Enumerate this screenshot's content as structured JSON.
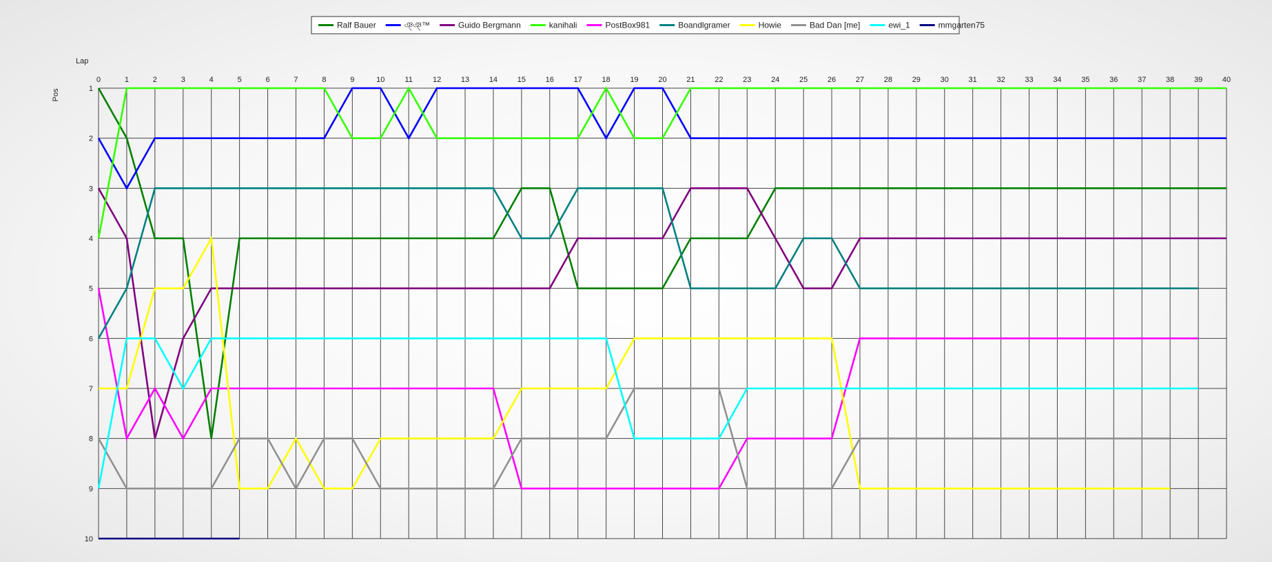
{
  "chart_data": {
    "type": "line",
    "xlabel": "Lap",
    "ylabel": "Pos",
    "xlim": [
      0,
      40
    ],
    "ylim": [
      1,
      10
    ],
    "y_inverted": true,
    "grid": true,
    "legend_position": "top-center",
    "x_ticks": [
      0,
      1,
      2,
      3,
      4,
      5,
      6,
      7,
      8,
      9,
      10,
      11,
      12,
      13,
      14,
      15,
      16,
      17,
      18,
      19,
      20,
      21,
      22,
      23,
      24,
      25,
      26,
      27,
      28,
      29,
      30,
      31,
      32,
      33,
      34,
      35,
      36,
      37,
      38,
      39,
      40
    ],
    "y_ticks": [
      1,
      2,
      3,
      4,
      5,
      6,
      7,
      8,
      9,
      10
    ],
    "series": [
      {
        "name": "Ralf Bauer",
        "color": "#008000",
        "values": [
          1,
          2,
          4,
          4,
          8,
          4,
          4,
          4,
          4,
          4,
          4,
          4,
          4,
          4,
          4,
          3,
          3,
          5,
          5,
          5,
          5,
          4,
          4,
          4,
          3,
          3,
          3,
          3,
          3,
          3,
          3,
          3,
          3,
          3,
          3,
          3,
          3,
          3,
          3,
          3,
          3
        ]
      },
      {
        "name": "ঞ্ঞ্™",
        "color": "#0000ff",
        "values": [
          2,
          3,
          2,
          2,
          2,
          2,
          2,
          2,
          2,
          1,
          1,
          2,
          1,
          1,
          1,
          1,
          1,
          1,
          2,
          1,
          1,
          2,
          2,
          2,
          2,
          2,
          2,
          2,
          2,
          2,
          2,
          2,
          2,
          2,
          2,
          2,
          2,
          2,
          2,
          2,
          2
        ]
      },
      {
        "name": "Guido Bergmann",
        "color": "#800080",
        "values": [
          3,
          4,
          8,
          6,
          5,
          5,
          5,
          5,
          5,
          5,
          5,
          5,
          5,
          5,
          5,
          5,
          5,
          4,
          4,
          4,
          4,
          3,
          3,
          3,
          4,
          5,
          5,
          4,
          4,
          4,
          4,
          4,
          4,
          4,
          4,
          4,
          4,
          4,
          4,
          4,
          4
        ]
      },
      {
        "name": "kanihali",
        "color": "#33ff00",
        "values": [
          4,
          1,
          1,
          1,
          1,
          1,
          1,
          1,
          1,
          2,
          2,
          1,
          2,
          2,
          2,
          2,
          2,
          2,
          1,
          2,
          2,
          1,
          1,
          1,
          1,
          1,
          1,
          1,
          1,
          1,
          1,
          1,
          1,
          1,
          1,
          1,
          1,
          1,
          1,
          1,
          1
        ]
      },
      {
        "name": "PostBox981",
        "color": "#ff00ff",
        "values": [
          5,
          8,
          7,
          8,
          7,
          7,
          7,
          7,
          7,
          7,
          7,
          7,
          7,
          7,
          7,
          9,
          9,
          9,
          9,
          9,
          9,
          9,
          9,
          8,
          8,
          8,
          8,
          6,
          6,
          6,
          6,
          6,
          6,
          6,
          6,
          6,
          6,
          6,
          6,
          6
        ]
      },
      {
        "name": "Boandlgramer",
        "color": "#008080",
        "values": [
          6,
          5,
          3,
          3,
          3,
          3,
          3,
          3,
          3,
          3,
          3,
          3,
          3,
          3,
          3,
          4,
          4,
          3,
          3,
          3,
          3,
          5,
          5,
          5,
          5,
          4,
          4,
          5,
          5,
          5,
          5,
          5,
          5,
          5,
          5,
          5,
          5,
          5,
          5,
          5
        ]
      },
      {
        "name": "Howie",
        "color": "#ffff00",
        "values": [
          7,
          7,
          5,
          5,
          4,
          9,
          9,
          8,
          9,
          9,
          8,
          8,
          8,
          8,
          8,
          7,
          7,
          7,
          7,
          6,
          6,
          6,
          6,
          6,
          6,
          6,
          6,
          9,
          9,
          9,
          9,
          9,
          9,
          9,
          9,
          9,
          9,
          9,
          9
        ]
      },
      {
        "name": "Bad Dan [me]",
        "color": "#909090",
        "values": [
          8,
          9,
          9,
          9,
          9,
          8,
          8,
          9,
          8,
          8,
          9,
          9,
          9,
          9,
          9,
          8,
          8,
          8,
          8,
          7,
          7,
          7,
          7,
          9,
          9,
          9,
          9,
          8,
          8,
          8,
          8,
          8,
          8,
          8,
          8,
          8,
          8,
          8,
          8
        ]
      },
      {
        "name": "ewi_1",
        "color": "#00ffff",
        "values": [
          9,
          6,
          6,
          7,
          6,
          6,
          6,
          6,
          6,
          6,
          6,
          6,
          6,
          6,
          6,
          6,
          6,
          6,
          6,
          8,
          8,
          8,
          8,
          7,
          7,
          7,
          7,
          7,
          7,
          7,
          7,
          7,
          7,
          7,
          7,
          7,
          7,
          7,
          7,
          7
        ]
      },
      {
        "name": "mmgarten75",
        "color": "#000080",
        "values": [
          10,
          10,
          10,
          10,
          10,
          10
        ]
      }
    ]
  }
}
